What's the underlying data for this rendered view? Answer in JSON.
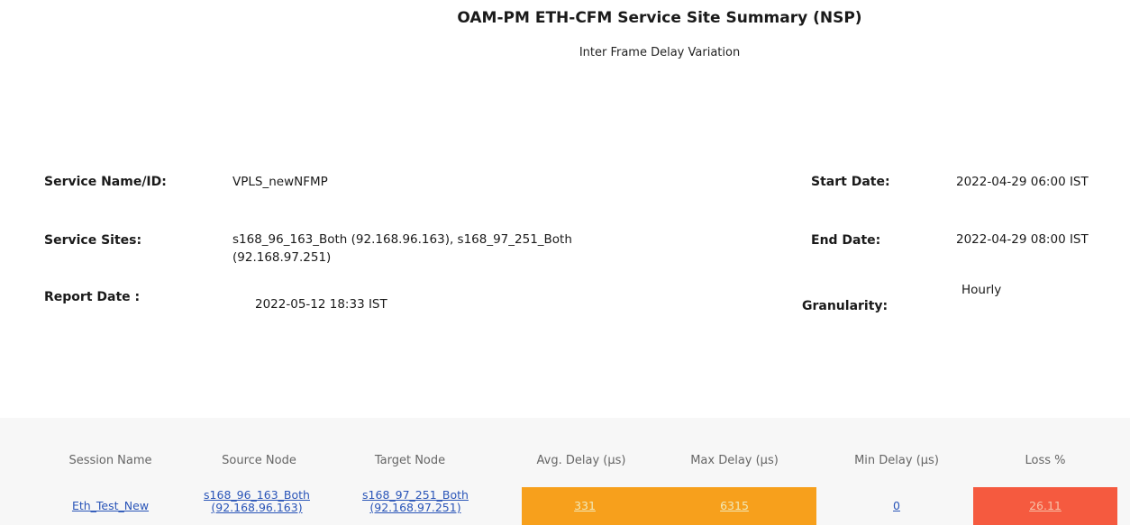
{
  "header": {
    "title": "OAM-PM ETH-CFM Service Site Summary (NSP)",
    "subtitle": "Inter Frame Delay Variation"
  },
  "info": {
    "service_name_label": "Service Name/ID:",
    "service_name_value": "VPLS_newNFMP",
    "service_sites_label": "Service Sites:",
    "service_sites_value_line1": "s168_96_163_Both (92.168.96.163), s168_97_251_Both",
    "service_sites_value_line2": "(92.168.97.251)",
    "report_date_label": "Report Date :",
    "report_date_value": "2022-05-12 18:33 IST",
    "start_date_label": "Start Date:",
    "start_date_value": "2022-04-29 06:00 IST",
    "end_date_label": "End Date:",
    "end_date_value": "2022-04-29 08:00 IST",
    "granularity_label": "Granularity:",
    "granularity_value": "Hourly"
  },
  "table": {
    "columns": [
      "Session Name",
      "Source Node",
      "Target Node",
      "Avg. Delay (µs)",
      "Max Delay (µs)",
      "Min Delay (µs)",
      "Loss %"
    ],
    "rows": [
      {
        "session_name": "Eth_Test_New",
        "source_node_line1": "s168_96_163_Both",
        "source_node_line2": "(92.168.96.163)",
        "target_node_line1": "s168_97_251_Both",
        "target_node_line2": "(92.168.97.251)",
        "avg_delay": "331",
        "max_delay": "6315",
        "min_delay": "0",
        "loss": "26.11"
      }
    ]
  },
  "colors": {
    "delay_highlight": "#f7a01c",
    "loss_highlight": "#f55a3f",
    "link": "#2a55b8",
    "table_background": "#f7f7f7"
  }
}
